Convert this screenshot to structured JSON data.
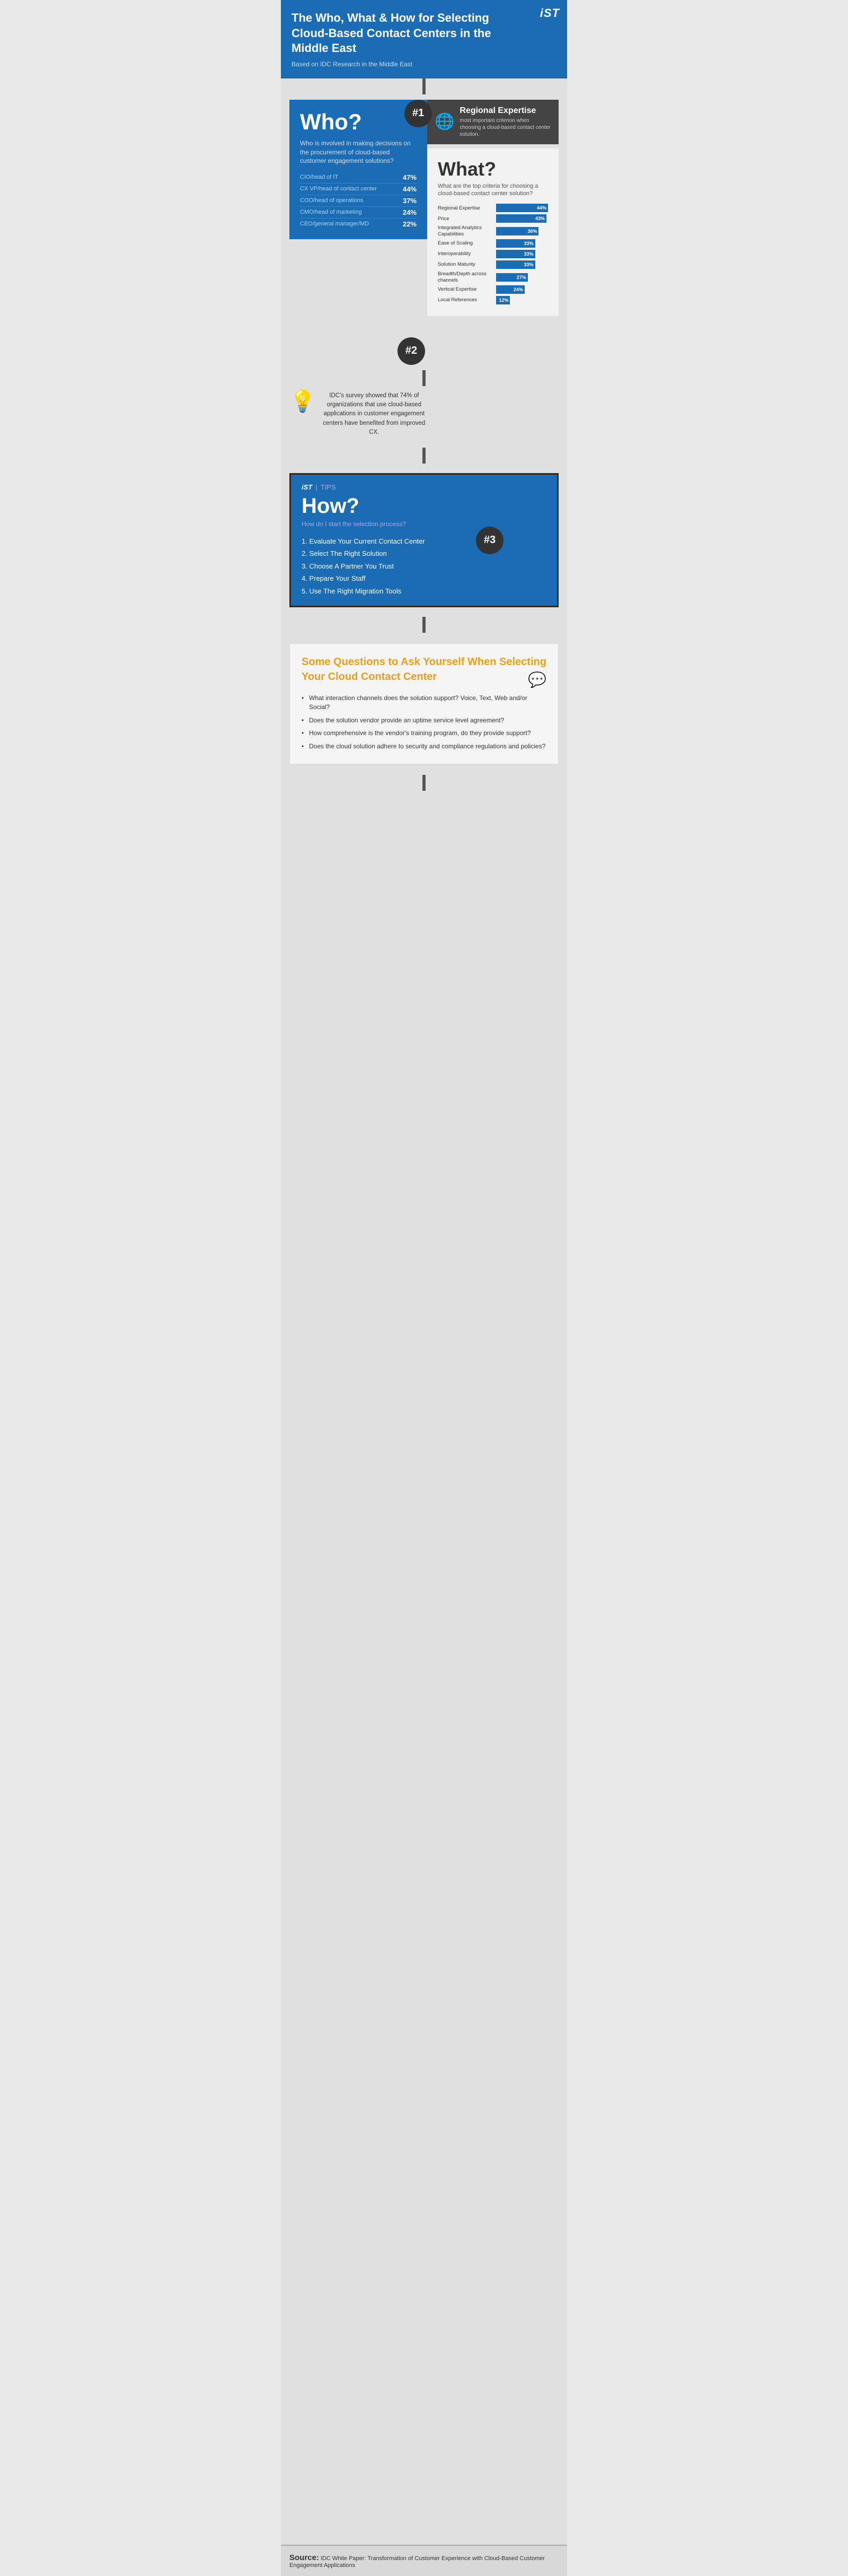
{
  "header": {
    "logo": "iST",
    "title": "The Who, What & How for Selecting Cloud-Based Contact Centers in the Middle East",
    "subtitle": "Based on IDC Research in the Middle East"
  },
  "who": {
    "heading": "Who?",
    "description": "Who is involved in making decisions on the procurement of cloud-based customer engagement solutions?",
    "rows": [
      {
        "label": "CIO/head of IT",
        "pct": "47%"
      },
      {
        "label": "CX VP/head of contact center",
        "pct": "44%"
      },
      {
        "label": "COO/head of operations",
        "pct": "37%"
      },
      {
        "label": "CMO/head of marketing",
        "pct": "24%"
      },
      {
        "label": "CEO/general manager/MD",
        "pct": "22%"
      }
    ],
    "badge": "#1"
  },
  "regional": {
    "heading": "Regional Expertise",
    "description": "most important criterion when choosing a cloud-based contact center solution."
  },
  "what": {
    "heading": "What?",
    "description": "What are the top criteria for choosing a cloud-based contact center solution?",
    "badge": "#2",
    "bars": [
      {
        "label": "Regional Expertise",
        "pct": 44,
        "pctLabel": "44%"
      },
      {
        "label": "Price",
        "pct": 43,
        "pctLabel": "43%"
      },
      {
        "label": "Integrated Analytics Capabilities",
        "pct": 36,
        "pctLabel": "36%"
      },
      {
        "label": "Ease of Scaling",
        "pct": 33,
        "pctLabel": "33%"
      },
      {
        "label": "Interoperability",
        "pct": 33,
        "pctLabel": "33%"
      },
      {
        "label": "Solution Maturity",
        "pct": 33,
        "pctLabel": "33%"
      },
      {
        "label": "Breadth/Depth across channels",
        "pct": 27,
        "pctLabel": "27%"
      },
      {
        "label": "Vertical Expertise",
        "pct": 24,
        "pctLabel": "24%"
      },
      {
        "label": "Local References",
        "pct": 12,
        "pctLabel": "12%"
      }
    ]
  },
  "bulb": {
    "stat": "IDC's survey showed that 74% of organizations that use cloud-based applications in customer engagement centers have benefited from improved CX."
  },
  "how": {
    "heading": "How?",
    "tips_ist": "iST",
    "tips_label": "TIPS",
    "subtitle": "How do I start the selection process?",
    "badge": "#3",
    "steps": [
      "1. Evaluate Your Current Contact Center",
      "2. Select The Right Solution",
      "3. Choose A Partner You Trust",
      "4. Prepare Your Staff",
      "5. Use The Right Migration Tools"
    ]
  },
  "questions": {
    "heading_static": "Some Questions to Ask Yourself When Selecting Your ",
    "heading_highlight": "Cloud Contact Center",
    "chat_icon": "💬",
    "items": [
      "What interaction channels does the solution support? Voice, Text, Web and/or Social?",
      "Does the solution vendor provide an uptime service level agreement?",
      "How comprehensive is the vendor's training program, do they provide support?",
      "Does the cloud solution adhere to security and compliance regulations and policies?"
    ]
  },
  "footer": {
    "source_label": "Source:",
    "source_text": "IDC White Paper: Transformation of Customer Experience with Cloud-Based Customer Engagement Applications"
  },
  "badges": {
    "one": "#1",
    "two": "#2",
    "three": "#3"
  }
}
